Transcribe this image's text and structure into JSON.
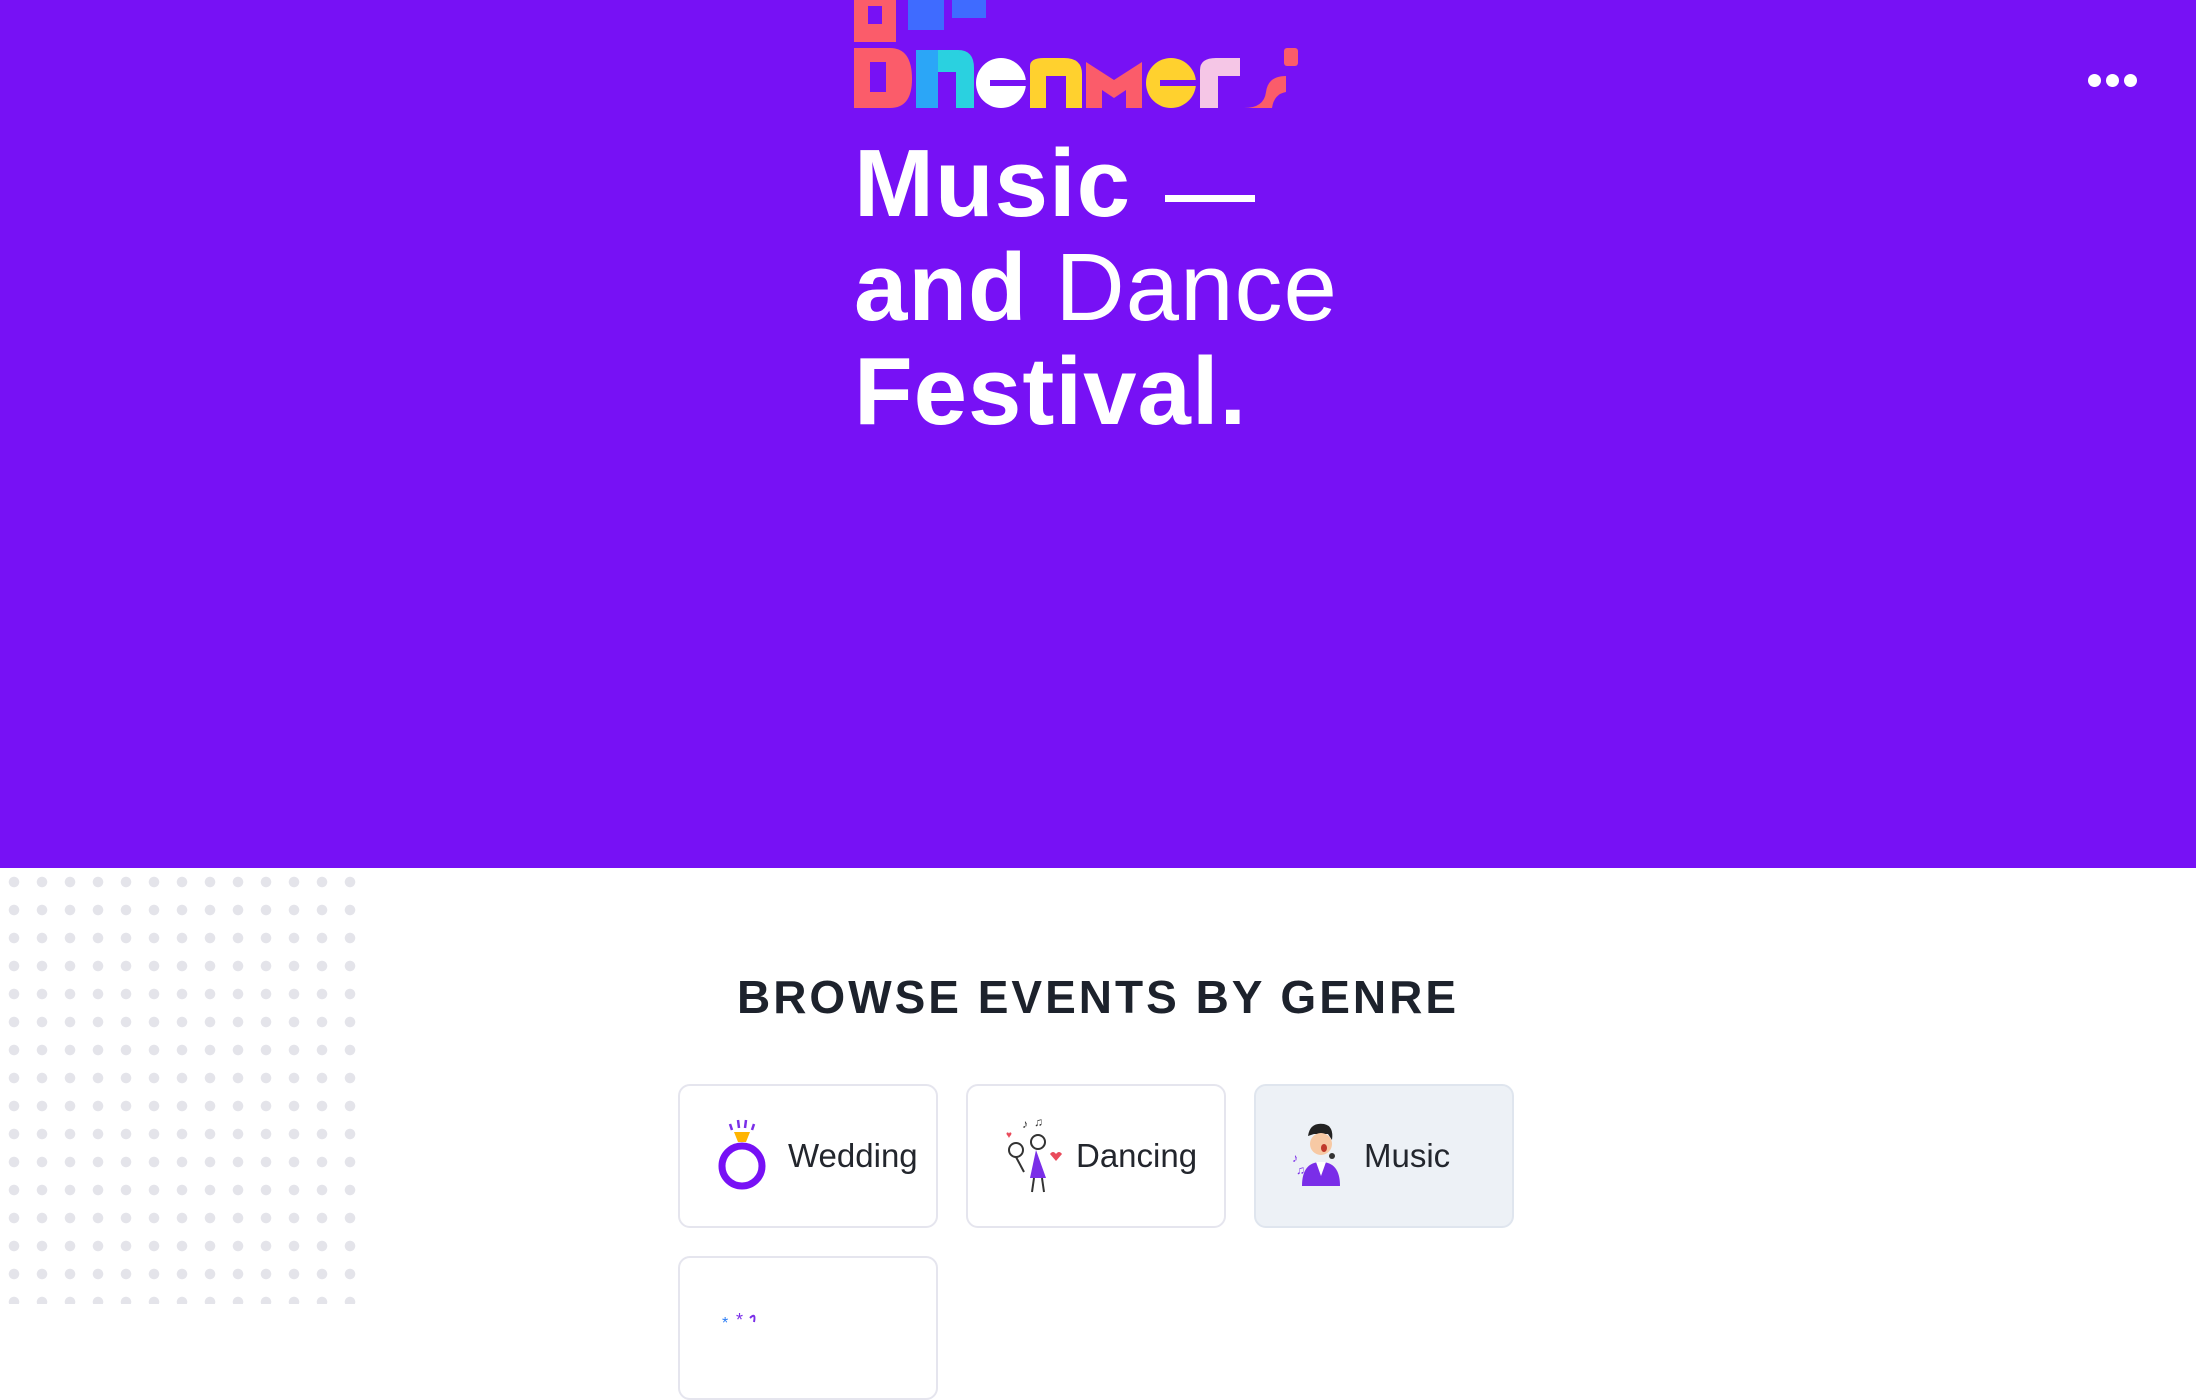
{
  "brand": {
    "name": "BAY DREAMERS",
    "logo_icon": "bay-dreamers-logo"
  },
  "header": {
    "menu_icon": "more-dots-icon"
  },
  "hero": {
    "line1": "Music",
    "line2_bold": "and",
    "line2_light": "Dance",
    "line3": "Festival.",
    "background_color": "#7711f5"
  },
  "genres": {
    "title": "BROWSE EVENTS BY GENRE",
    "items": [
      {
        "label": "Wedding",
        "icon": "wedding-ring-icon"
      },
      {
        "label": "Dancing",
        "icon": "dancing-couple-icon"
      },
      {
        "label": "Music",
        "icon": "singer-icon",
        "active": true
      },
      {
        "label": "",
        "icon": "party-confetti-icon"
      }
    ]
  }
}
